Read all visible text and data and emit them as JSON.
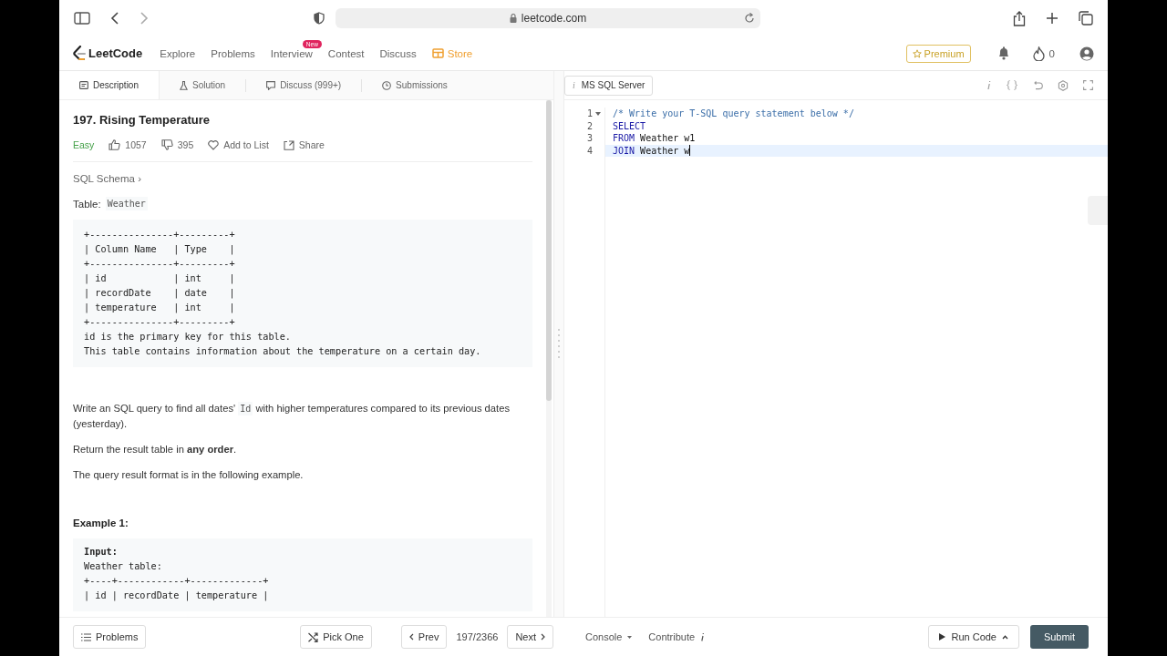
{
  "browser": {
    "url": "leetcode.com"
  },
  "nav": {
    "logo": "LeetCode",
    "items": [
      {
        "label": "Explore",
        "kind": "plain"
      },
      {
        "label": "Problems",
        "kind": "plain"
      },
      {
        "label": "Interview",
        "kind": "plain",
        "badge": "New"
      },
      {
        "label": "Contest",
        "kind": "plain"
      },
      {
        "label": "Discuss",
        "kind": "plain"
      },
      {
        "label": "Store",
        "kind": "store"
      }
    ],
    "premium": "Premium",
    "streak": "0"
  },
  "tabs": [
    {
      "label": "Description",
      "selected": true
    },
    {
      "label": "Solution",
      "selected": false
    },
    {
      "label": "Discuss (999+)",
      "selected": false
    },
    {
      "label": "Submissions",
      "selected": false
    }
  ],
  "problem": {
    "title": "197. Rising Temperature",
    "difficulty": "Easy",
    "likes": "1057",
    "dislikes": "395",
    "add_to_list": "Add to List",
    "share": "Share",
    "schema_link": "SQL Schema ›",
    "table_label": "Table:",
    "table_name": "Weather",
    "schema_block": [
      "+---------------+---------+",
      "| Column Name   | Type    |",
      "+---------------+---------+",
      "| id            | int     |",
      "| recordDate    | date    |",
      "| temperature   | int     |",
      "+---------------+---------+",
      "id is the primary key for this table.",
      "This table contains information about the temperature on a certain day."
    ],
    "question": {
      "before": "Write an SQL query to find all dates'",
      "code": "Id",
      "after": "with higher temperatures compared to its previous dates (yesterday)."
    },
    "paragraphs": [
      "Return the result table in **any order**.",
      "The query result format is in the following example."
    ],
    "example_title": "Example 1:",
    "example_block": [
      {
        "text": "Input:",
        "bold": true
      },
      {
        "text": "Weather table:",
        "bold": false
      },
      {
        "text": "+----+------------+-------------+",
        "bold": false
      },
      {
        "text": "| id | recordDate | temperature |",
        "bold": false
      }
    ]
  },
  "editor": {
    "language_icon": "i",
    "language": "MS SQL Server",
    "lines": [
      {
        "number": "1",
        "foldable": true,
        "active": false,
        "tokens": [
          {
            "text": "/* Write your T-SQL query statement below */",
            "kind": "comment"
          }
        ]
      },
      {
        "number": "2",
        "foldable": false,
        "active": false,
        "tokens": [
          {
            "text": "SELECT",
            "kind": "keyword"
          }
        ]
      },
      {
        "number": "3",
        "foldable": false,
        "active": false,
        "tokens": [
          {
            "text": "FROM",
            "kind": "keyword"
          },
          {
            "text": " Weather w1",
            "kind": "plain"
          }
        ]
      },
      {
        "number": "4",
        "foldable": false,
        "active": true,
        "tokens": [
          {
            "text": "JOIN",
            "kind": "keyword"
          },
          {
            "text": " Weather w",
            "kind": "plain"
          }
        ]
      }
    ]
  },
  "footer": {
    "problems": "Problems",
    "pick_one": "Pick One",
    "prev": "Prev",
    "position": "197/2366",
    "next": "Next",
    "console": "Console",
    "contribute": "Contribute",
    "run_code": "Run Code",
    "submit": "Submit"
  }
}
